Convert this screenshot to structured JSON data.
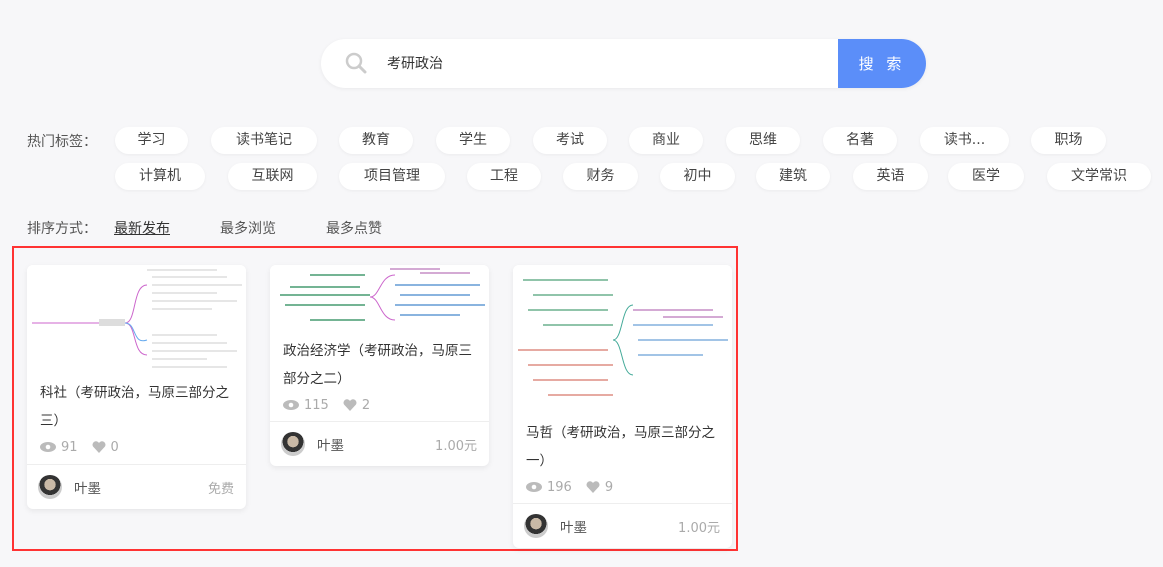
{
  "search": {
    "value": "考研政治",
    "button": "搜 索"
  },
  "tags": {
    "label": "热门标签：",
    "items": [
      "学习",
      "读书笔记",
      "教育",
      "学生",
      "考试",
      "商业",
      "思维",
      "名著",
      "读书...",
      "职场",
      "计算机",
      "互联网",
      "项目管理",
      "工程",
      "财务",
      "初中",
      "建筑",
      "英语",
      "医学",
      "文学常识"
    ]
  },
  "sort": {
    "label": "排序方式：",
    "options": [
      "最新发布",
      "最多浏览",
      "最多点赞"
    ],
    "active": "最新发布"
  },
  "colors": {
    "accent": "#5b8ef9",
    "highlight": "#ff3333"
  },
  "cards": [
    {
      "title": "科社（考研政治，马原三部分之三）",
      "views": "91",
      "likes": "0",
      "author": "叶墨",
      "price": "免费"
    },
    {
      "title": "政治经济学（考研政治，马原三部分之二）",
      "views": "115",
      "likes": "2",
      "author": "叶墨",
      "price": "1.00元"
    },
    {
      "title": "马哲（考研政治，马原三部分之一）",
      "views": "196",
      "likes": "9",
      "author": "叶墨",
      "price": "1.00元"
    }
  ]
}
